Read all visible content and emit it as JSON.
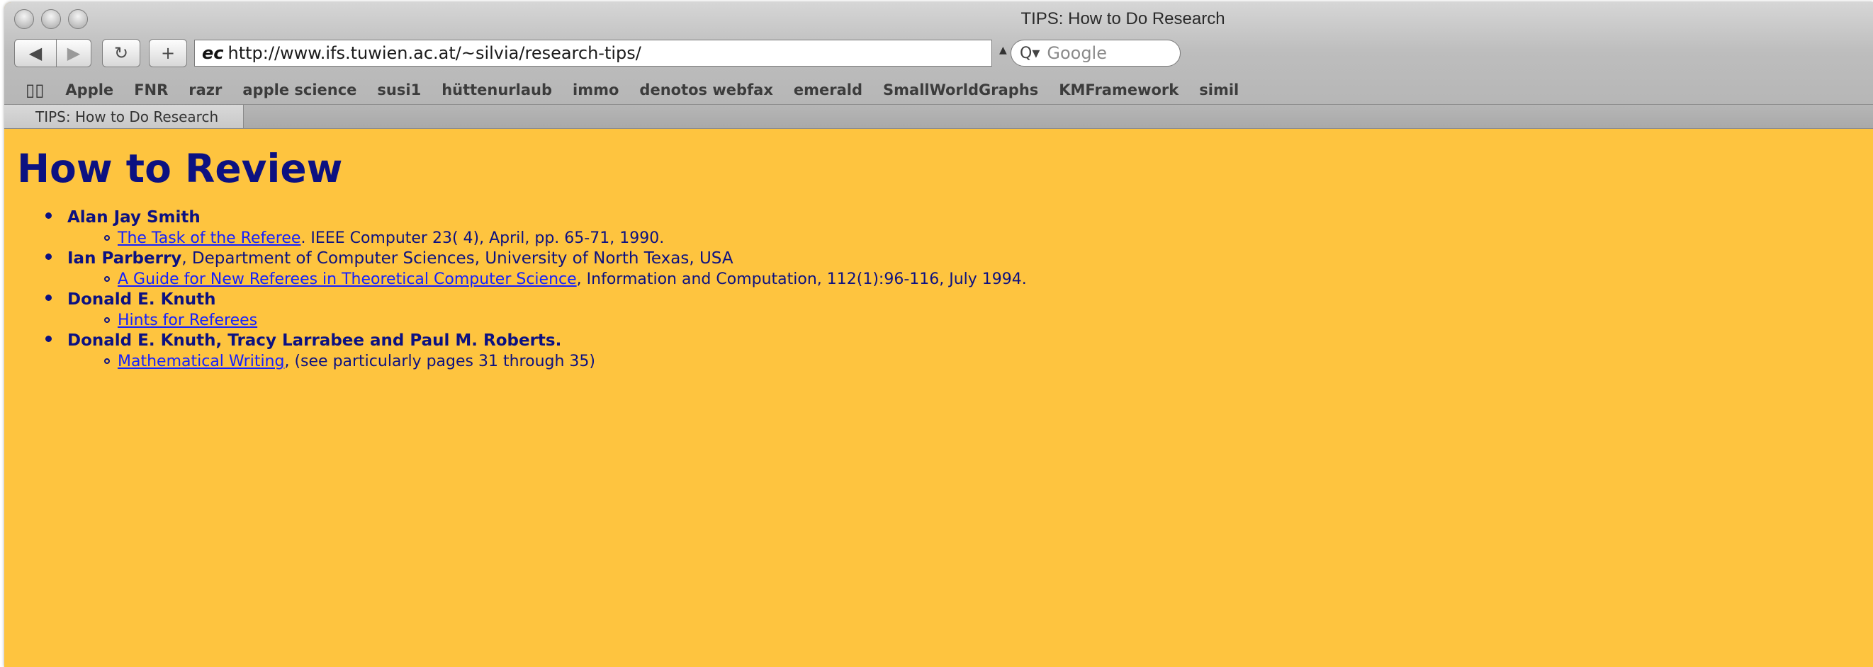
{
  "window": {
    "title": "TIPS: How to Do Research"
  },
  "toolbar": {
    "back_icon": "◀",
    "forward_icon": "▶",
    "reload_icon": "↻",
    "add_icon": "+",
    "site_icon_text": "ec",
    "url": "http://www.ifs.tuwien.ac.at/~silvia/research-tips/",
    "search_placeholder": "Google"
  },
  "bookmarks": [
    "Apple",
    "FNR",
    "razr",
    "apple science",
    "susi1",
    "hüttenurlaub",
    "immo",
    "denotos webfax",
    "emerald",
    "SmallWorldGraphs",
    "KMFramework",
    "simil"
  ],
  "tab": {
    "label": "TIPS: How to Do Research"
  },
  "page": {
    "heading": "How to Review",
    "entries": [
      {
        "author": "Alan Jay Smith",
        "affiliation": "",
        "link_text": "The Task of the Referee",
        "citation": ". IEEE Computer 23( 4), April, pp. 65-71, 1990."
      },
      {
        "author": "Ian Parberry",
        "affiliation": ", Department of Computer Sciences, University of North Texas, USA",
        "link_text": "A Guide for New Referees in Theoretical Computer Science",
        "citation": ", Information and Computation, 112(1):96-116, July 1994."
      },
      {
        "author": "Donald E. Knuth",
        "affiliation": "",
        "link_text": "Hints for Referees",
        "citation": ""
      },
      {
        "author": "Donald E. Knuth, Tracy Larrabee and Paul M. Roberts.",
        "affiliation": "",
        "link_text": "Mathematical Writing",
        "citation": ", (see particularly pages 31 through 35)"
      }
    ]
  },
  "colors": {
    "page_background": "#fec43f",
    "text": "#0c1181",
    "link": "#1420ff"
  }
}
